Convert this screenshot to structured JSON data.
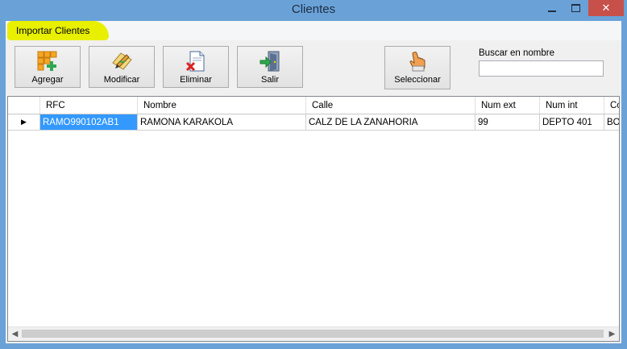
{
  "window": {
    "title": "Clientes",
    "close_glyph": "✕"
  },
  "menu": {
    "items": [
      {
        "label": "Importar Clientes"
      }
    ]
  },
  "toolbar": {
    "buttons": [
      {
        "label": "Agregar",
        "icon": "add-grid-icon"
      },
      {
        "label": "Modificar",
        "icon": "edit-pencil-icon"
      },
      {
        "label": "Eliminar",
        "icon": "delete-document-icon"
      },
      {
        "label": "Salir",
        "icon": "exit-door-icon"
      },
      {
        "label": "Seleccionar",
        "icon": "hand-pointer-icon"
      }
    ]
  },
  "search": {
    "label": "Buscar en nombre",
    "value": ""
  },
  "grid": {
    "columns": [
      "RFC",
      "Nombre",
      "Calle",
      "Num ext",
      "Num int",
      "Co"
    ],
    "rows": [
      {
        "indicator": "▶",
        "cells": [
          "RAMO990102AB1",
          "RAMONA KARAKOLA",
          "CALZ DE LA ZANAHORIA",
          "99",
          "DEPTO 401",
          "BO"
        ]
      }
    ]
  },
  "scrollbar": {
    "left_arrow": "◀",
    "right_arrow": "▶"
  },
  "colors": {
    "titlebar": "#6aa2d8",
    "close": "#c7504a",
    "selection": "#3399ff",
    "highlight": "#e8f000"
  }
}
